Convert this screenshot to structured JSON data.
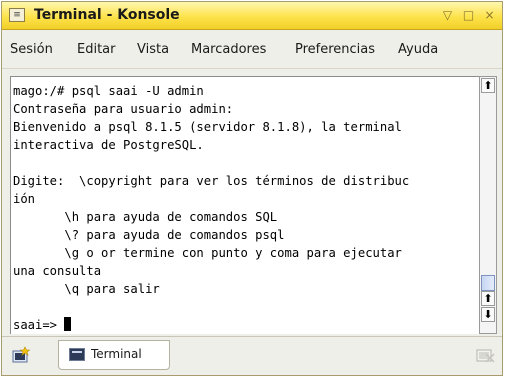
{
  "window": {
    "title": "Terminal - Konsole",
    "app_icon": "terminal-app-icon",
    "buttons": {
      "minimize_glyph": "▽",
      "maximize_glyph": "□",
      "close_glyph": "×"
    },
    "titlebar_color": "#fde34b"
  },
  "menu": {
    "items": [
      {
        "label": "Sesión"
      },
      {
        "label": "Editar"
      },
      {
        "label": "Vista"
      },
      {
        "label": "Marcadores"
      },
      {
        "label": "Preferencias"
      },
      {
        "label": "Ayuda"
      }
    ]
  },
  "terminal": {
    "lines": [
      "mago:/# psql saai -U admin",
      "Contraseña para usuario admin:",
      "Bienvenido a psql 8.1.5 (servidor 8.1.8), la terminal",
      "interactiva de PostgreSQL.",
      "",
      "Digite:  \\copyright para ver los términos de distribuc",
      "ión",
      "       \\h para ayuda de comandos SQL",
      "       \\? para ayuda de comandos psql",
      "       \\g o or termine con punto y coma para ejecutar",
      "una consulta",
      "       \\q para salir",
      ""
    ],
    "prompt": "saai=> "
  },
  "scrollbar": {
    "up_glyph": "⬆",
    "down_glyph": "⬇",
    "position_fraction": 1.0
  },
  "tabbar": {
    "new_tab_icon": "new-session-icon",
    "tabs": [
      {
        "label": "Terminal",
        "icon": "terminal-icon"
      }
    ],
    "close_tab_icon": "close-session-icon"
  }
}
